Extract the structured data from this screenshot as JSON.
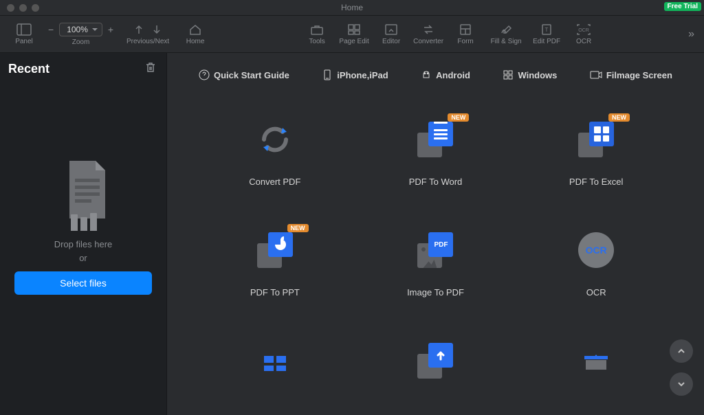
{
  "window": {
    "title": "Home",
    "free_trial_badge": "Free Trial"
  },
  "toolbar": {
    "panel": "Panel",
    "zoom_label": "Zoom",
    "zoom_value": "100%",
    "prev_next": "Previous/Next",
    "home": "Home",
    "tools": "Tools",
    "page_edit": "Page Edit",
    "editor": "Editor",
    "converter": "Converter",
    "form": "Form",
    "fill_sign": "Fill & Sign",
    "edit_pdf": "Edit PDF",
    "ocr": "OCR"
  },
  "sidebar": {
    "recent_heading": "Recent",
    "drop_line1": "Drop files here",
    "drop_line2": "or",
    "select_button": "Select files"
  },
  "quicklinks": [
    {
      "label": "Quick Start Guide"
    },
    {
      "label": "iPhone,iPad"
    },
    {
      "label": "Android"
    },
    {
      "label": "Windows"
    },
    {
      "label": "Filmage Screen"
    }
  ],
  "cards": [
    {
      "label": "Convert PDF",
      "badge": null
    },
    {
      "label": "PDF To Word",
      "badge": "NEW"
    },
    {
      "label": "PDF To Excel",
      "badge": "NEW"
    },
    {
      "label": "PDF To PPT",
      "badge": "NEW"
    },
    {
      "label": "Image To PDF",
      "badge": null
    },
    {
      "label": "OCR",
      "badge": null
    }
  ],
  "ocr_text": "OCR",
  "pdf_text": "PDF"
}
